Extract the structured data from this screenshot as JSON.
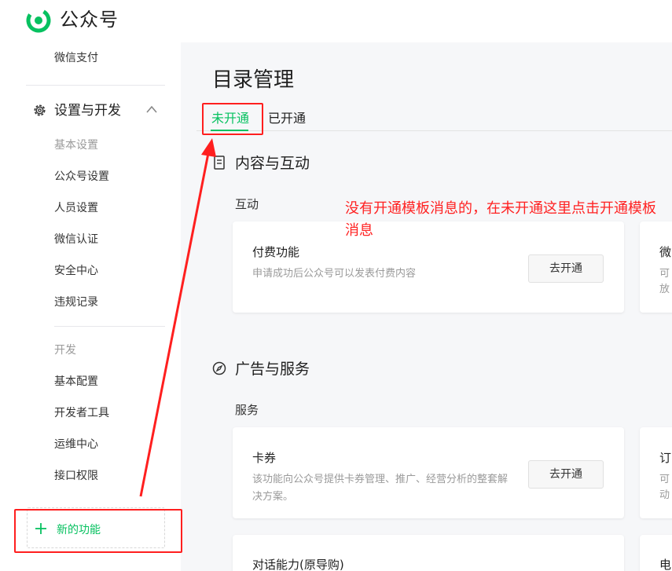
{
  "app": {
    "brand": "公众号"
  },
  "sidebar": {
    "top_item": "微信支付",
    "section": {
      "label": "设置与开发"
    },
    "group_basic": {
      "label": "基本设置",
      "items": [
        "公众号设置",
        "人员设置",
        "微信认证",
        "安全中心",
        "违规记录"
      ]
    },
    "group_dev": {
      "label": "开发",
      "items": [
        "基本配置",
        "开发者工具",
        "运维中心",
        "接口权限"
      ]
    },
    "new_function": "新的功能"
  },
  "main": {
    "title": "目录管理",
    "tabs": [
      {
        "label": "未开通",
        "active": true
      },
      {
        "label": "已开通",
        "active": false
      }
    ],
    "categories": [
      {
        "title": "内容与互动",
        "subtitle": "互动",
        "cards": [
          {
            "title": "付费功能",
            "desc": "申请成功后公众号可以发表付费内容",
            "button": "去开通"
          }
        ],
        "peek": {
          "title": "微",
          "desc1": "可",
          "desc2": "放"
        }
      },
      {
        "title": "广告与服务",
        "subtitle": "服务",
        "cards": [
          {
            "title": "卡券",
            "desc": "该功能向公众号提供卡券管理、推广、经营分析的整套解决方案。",
            "button": "去开通"
          },
          {
            "title": "对话能力(原导购)",
            "desc": "",
            "button": ""
          }
        ],
        "peek": {
          "title": "订",
          "desc1": "可",
          "desc2": "动",
          "title2": "电"
        }
      }
    ]
  },
  "annotation": {
    "text": "没有开通模板消息的，在未开通这里点击开通模板消息",
    "color": "#ff2222"
  },
  "colors": {
    "accent": "#07c160",
    "annotation": "#ff1f1f"
  },
  "icons": [
    "wechat-logo",
    "gear-icon",
    "chevron-up-icon",
    "plus-icon",
    "document-icon",
    "compass-icon"
  ]
}
